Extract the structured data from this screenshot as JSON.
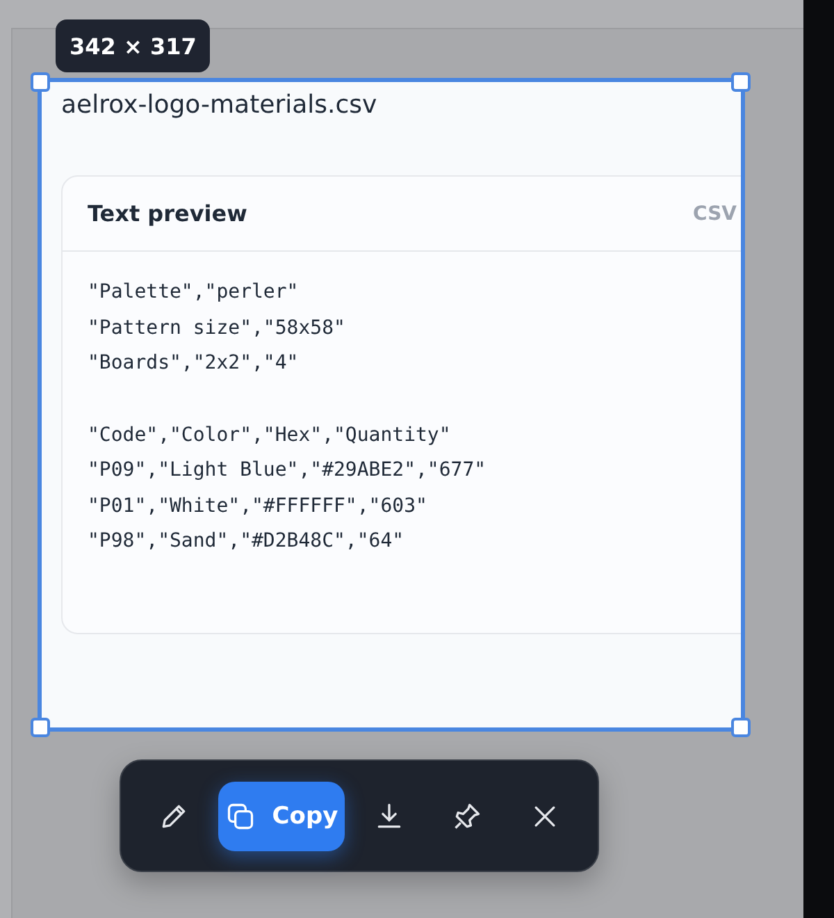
{
  "selection": {
    "size_label": "342 × 317"
  },
  "file": {
    "title": "aelrox-logo-materials.csv"
  },
  "preview": {
    "title": "Text preview",
    "format": "CSV",
    "blocks": [
      [
        "\"Palette\",\"perler\"",
        "\"Pattern size\",\"58x58\"",
        "\"Boards\",\"2x2\",\"4\""
      ],
      [
        "\"Code\",\"Color\",\"Hex\",\"Quantity\"",
        "\"P09\",\"Light Blue\",\"#29ABE2\",\"677\"",
        "\"P01\",\"White\",\"#FFFFFF\",\"603\"",
        "\"P98\",\"Sand\",\"#D2B48C\",\"64\""
      ]
    ]
  },
  "toolbar": [
    {
      "kind": "edit",
      "primary": false
    },
    {
      "kind": "copy",
      "label": "Copy",
      "primary": true
    },
    {
      "kind": "download",
      "primary": false
    },
    {
      "kind": "pin",
      "primary": false
    },
    {
      "kind": "close",
      "primary": false
    }
  ]
}
